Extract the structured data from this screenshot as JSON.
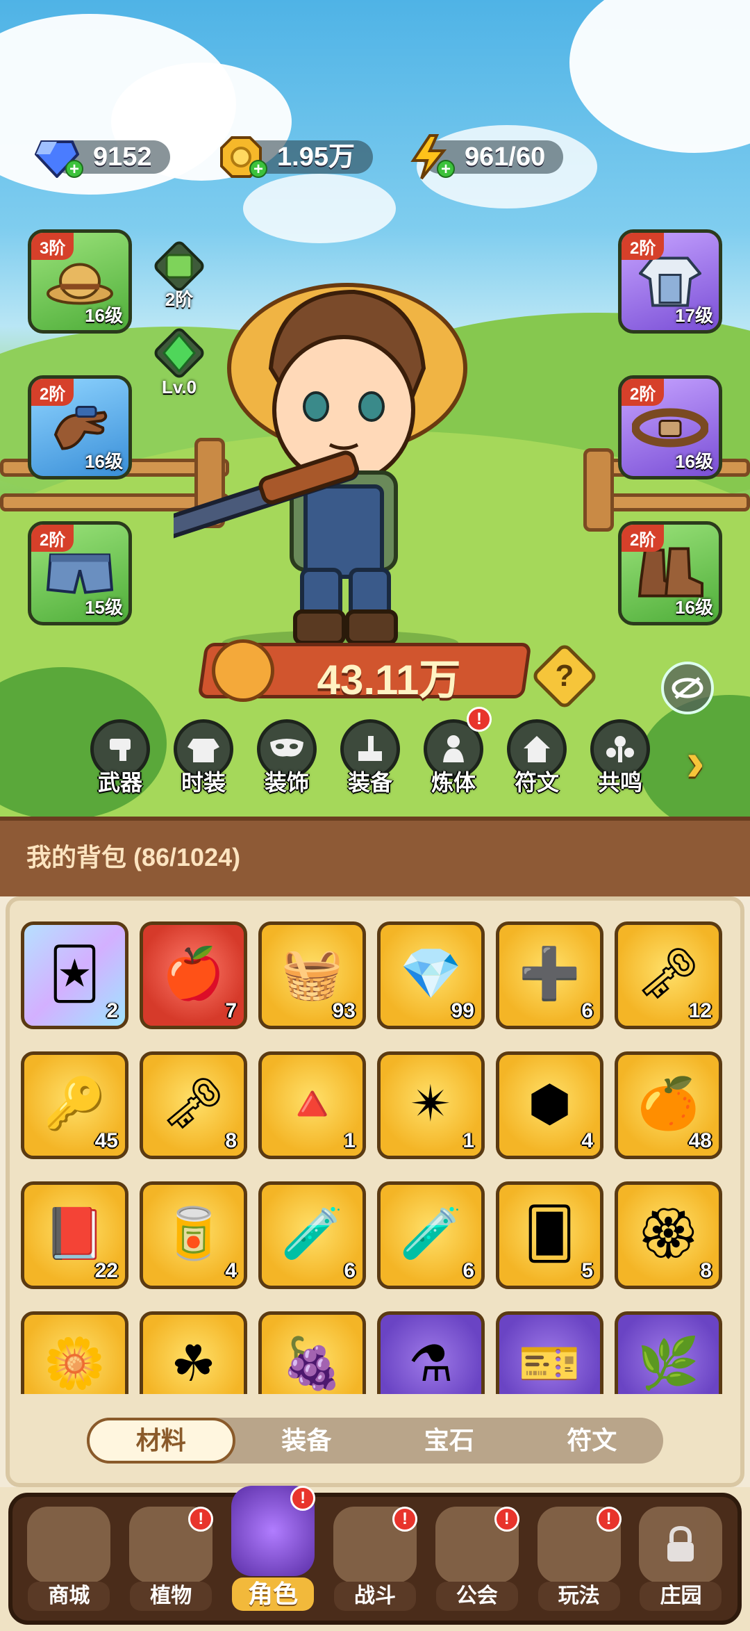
{
  "currency": {
    "diamonds": "9152",
    "gold": "1.95万",
    "energy": "961/60"
  },
  "equipment": {
    "left": [
      {
        "tier": "3阶",
        "level": "16级",
        "icon": "straw-hat-icon",
        "rarity": "green"
      },
      {
        "tier": "2阶",
        "level": "16级",
        "icon": "glove-icon",
        "rarity": "blue"
      },
      {
        "tier": "2阶",
        "level": "15级",
        "icon": "shorts-icon",
        "rarity": "green"
      }
    ],
    "right": [
      {
        "tier": "2阶",
        "level": "17级",
        "icon": "shirt-icon",
        "rarity": "purple"
      },
      {
        "tier": "2阶",
        "level": "16级",
        "icon": "belt-icon",
        "rarity": "purple"
      },
      {
        "tier": "2阶",
        "level": "16级",
        "icon": "boots-icon",
        "rarity": "green"
      }
    ],
    "badges": [
      {
        "caption": "2阶",
        "icon": "scroll-gem-icon"
      },
      {
        "caption": "Lv.0",
        "icon": "green-gem-icon"
      }
    ]
  },
  "power": "43.11万",
  "help_label": "?",
  "tabs": [
    {
      "label": "武器",
      "icon": "weapon-icon",
      "alert": false
    },
    {
      "label": "时装",
      "icon": "costume-icon",
      "alert": false
    },
    {
      "label": "装饰",
      "icon": "mask-icon",
      "alert": false
    },
    {
      "label": "装备",
      "icon": "equipment-icon",
      "alert": false
    },
    {
      "label": "炼体",
      "icon": "body-refine-icon",
      "alert": true
    },
    {
      "label": "符文",
      "icon": "rune-icon",
      "alert": false
    },
    {
      "label": "共鸣",
      "icon": "resonance-icon",
      "alert": false
    }
  ],
  "alert_mark": "!",
  "next_arrow": "›",
  "bag": {
    "title": "我的背包 (86/1024)",
    "items": [
      {
        "count": "2",
        "icon": "holo-card-icon",
        "bg": "holo"
      },
      {
        "count": "7",
        "icon": "red-potion-icon",
        "bg": "red"
      },
      {
        "count": "93",
        "icon": "bread-basket-icon",
        "bg": "gold"
      },
      {
        "count": "99",
        "icon": "crystal-icon",
        "bg": "gold"
      },
      {
        "count": "6",
        "icon": "plus-one-icon",
        "bg": "gold"
      },
      {
        "count": "12",
        "icon": "ruby-key-icon",
        "bg": "gold"
      },
      {
        "count": "45",
        "icon": "gold-key-icon",
        "bg": "gold"
      },
      {
        "count": "8",
        "icon": "emerald-key-icon",
        "bg": "gold"
      },
      {
        "count": "1",
        "icon": "fire-prism-icon",
        "bg": "gold"
      },
      {
        "count": "1",
        "icon": "star-orb-icon",
        "bg": "gold"
      },
      {
        "count": "4",
        "icon": "dark-rune-icon",
        "bg": "gold"
      },
      {
        "count": "48",
        "icon": "orange-potion-icon",
        "bg": "gold"
      },
      {
        "count": "22",
        "icon": "spell-book-icon",
        "bg": "gold"
      },
      {
        "count": "4",
        "icon": "can-icon",
        "bg": "gold"
      },
      {
        "count": "6",
        "icon": "teal-flask-icon",
        "bg": "gold"
      },
      {
        "count": "6",
        "icon": "red-flask-icon",
        "bg": "gold"
      },
      {
        "count": "5",
        "icon": "card-back-icon",
        "bg": "gold"
      },
      {
        "count": "8",
        "icon": "flower-medal-icon",
        "bg": "gold"
      },
      {
        "count": "",
        "icon": "sun-flower-icon",
        "bg": "gold"
      },
      {
        "count": "",
        "icon": "knot-icon",
        "bg": "gold"
      },
      {
        "count": "",
        "icon": "grape-icon",
        "bg": "gold"
      },
      {
        "count": "",
        "icon": "purple-potion-icon",
        "bg": "purple"
      },
      {
        "count": "",
        "icon": "ticket-icon",
        "bg": "purple"
      },
      {
        "count": "",
        "icon": "leaf-icon",
        "bg": "purple"
      }
    ],
    "filters": [
      "材料",
      "装备",
      "宝石",
      "符文"
    ],
    "active_filter": "材料"
  },
  "nav": [
    {
      "label": "商城",
      "icon": "shop-icon",
      "alert": false,
      "active": false
    },
    {
      "label": "植物",
      "icon": "plant-icon",
      "alert": true,
      "active": false
    },
    {
      "label": "角色",
      "icon": "character-icon",
      "alert": true,
      "active": true
    },
    {
      "label": "战斗",
      "icon": "battle-icon",
      "alert": true,
      "active": false
    },
    {
      "label": "公会",
      "icon": "guild-icon",
      "alert": true,
      "active": false
    },
    {
      "label": "玩法",
      "icon": "gameplay-icon",
      "alert": true,
      "active": false
    },
    {
      "label": "庄园",
      "icon": "locked-manor-icon",
      "alert": false,
      "active": false
    }
  ]
}
